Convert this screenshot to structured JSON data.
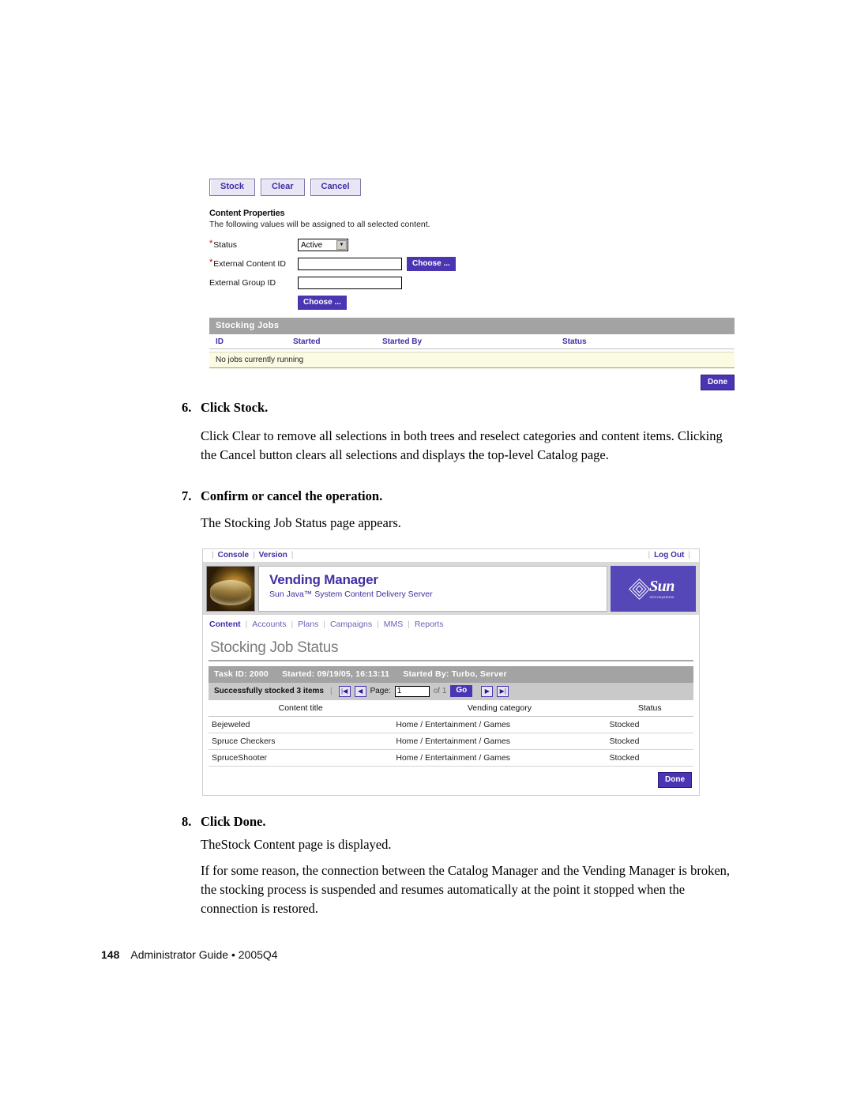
{
  "shot1": {
    "buttons": [
      {
        "label": "Stock"
      },
      {
        "label": "Clear"
      },
      {
        "label": "Cancel"
      }
    ],
    "section_title": "Content Properties",
    "section_subtitle": "The following values will be assigned to all selected content.",
    "fields": {
      "status_label": "Status",
      "status_value": "Active",
      "status_options": [
        "Active"
      ],
      "external_content_id_label": "External Content ID",
      "external_content_id_value": "",
      "external_group_id_label": "External Group ID",
      "external_group_id_value": "",
      "choose_label": "Choose ...",
      "choose_label_2": "Choose ..."
    },
    "jobs": {
      "panel_title": "Stocking Jobs",
      "columns": [
        "ID",
        "Started",
        "Started By",
        "Status"
      ],
      "empty_message": "No jobs currently running"
    },
    "done_label": "Done",
    "colors": {
      "accent_purple": "#4b35b3",
      "link_purple": "#3f2fa5",
      "panel_gray": "#a3a3a3",
      "empty_row_yellow": "#fbfbe4"
    }
  },
  "steps": {
    "step6": {
      "number": "6.",
      "heading": "Click Stock.",
      "body": "Click Clear to remove all selections in both trees and reselect categories and content items. Clicking the Cancel button clears all selections and displays the top-level Catalog page."
    },
    "step7": {
      "number": "7.",
      "heading": "Confirm or cancel the operation.",
      "body": "The Stocking Job Status page appears."
    },
    "step8": {
      "number": "8.",
      "heading": "Click Done.",
      "body1": "TheStock Content page is displayed.",
      "body2": "If for some reason, the connection between the Catalog Manager and the Vending Manager is broken, the stocking process is suspended and resumes automatically at the point it stopped when the connection is restored."
    }
  },
  "shot2": {
    "topnav": {
      "console": "Console",
      "version": "Version",
      "logout": "Log Out"
    },
    "banner": {
      "title": "Vending Manager",
      "subtitle": "Sun Java™ System Content Delivery Server",
      "logo_word": "Sun",
      "logo_tagline": "microsystems"
    },
    "tabs": [
      {
        "label": "Content",
        "active": true
      },
      {
        "label": "Accounts",
        "active": false
      },
      {
        "label": "Plans",
        "active": false
      },
      {
        "label": "Campaigns",
        "active": false
      },
      {
        "label": "MMS",
        "active": false
      },
      {
        "label": "Reports",
        "active": false
      }
    ],
    "page_title": "Stocking Job Status",
    "taskbar": {
      "task_id": "Task ID: 2000",
      "started": "Started: 09/19/05, 16:13:11",
      "started_by": "Started By: Turbo, Server"
    },
    "pager": {
      "summary": "Successfully stocked 3 items",
      "first_icon": "first-page-icon",
      "prev_icon": "previous-page-icon",
      "page_label": "Page:",
      "page_value": "1",
      "of_label": "of 1",
      "go_label": "Go",
      "next_icon": "next-page-icon",
      "last_icon": "last-page-icon"
    },
    "table": {
      "columns": [
        "Content title",
        "Vending category",
        "Status"
      ],
      "rows": [
        {
          "title": "Bejeweled",
          "category": "Home / Entertainment / Games",
          "status": "Stocked"
        },
        {
          "title": "Spruce Checkers",
          "category": "Home / Entertainment / Games",
          "status": "Stocked"
        },
        {
          "title": "SpruceShooter",
          "category": "Home / Entertainment / Games",
          "status": "Stocked"
        }
      ]
    },
    "done_label": "Done"
  },
  "footer": {
    "page_number": "148",
    "text": "Administrator Guide • 2005Q4"
  }
}
